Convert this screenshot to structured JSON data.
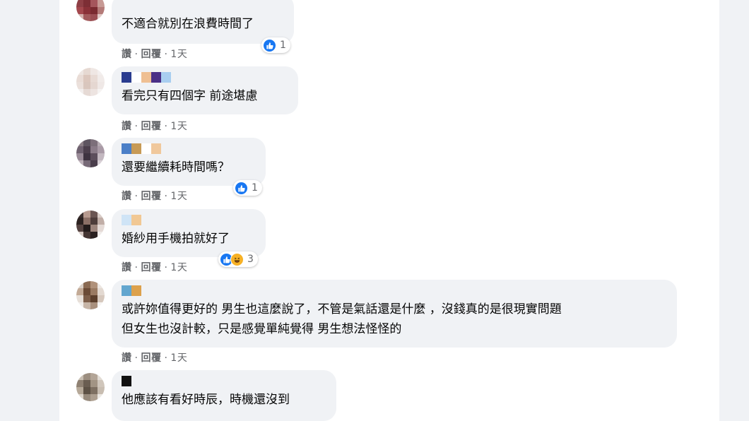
{
  "colors": {
    "bubble": "#f0f2f5",
    "like": "#1877f2",
    "haha": "#f7b125",
    "meta": "#65676b"
  },
  "actions": {
    "like": "讚",
    "reply": "回覆",
    "dot": "·"
  },
  "comments": [
    {
      "text": "不適合就別在浪費時間了",
      "time": "1天",
      "reactions": {
        "icons": [
          "like-icon"
        ],
        "count": "1"
      }
    },
    {
      "text": "看完只有四個字 前途堪慮",
      "time": "1天"
    },
    {
      "text": "還要繼續耗時間嗎？",
      "time": "1天",
      "reactions": {
        "icons": [
          "like-icon"
        ],
        "count": "1"
      }
    },
    {
      "text": "婚紗用手機拍就好了",
      "time": "1天",
      "reactions": {
        "icons": [
          "like-icon",
          "haha-icon"
        ],
        "count": "3"
      }
    },
    {
      "text": "或許妳值得更好的 男生也這麼說了，不管是氣話還是什麼 ，沒錢真的是很現實問題",
      "text2": "但女生也沒計較，只是感覺單純覺得 男生想法怪怪的",
      "time": "1天"
    },
    {
      "text": "他應該有看好時辰，時機還沒到"
    }
  ]
}
